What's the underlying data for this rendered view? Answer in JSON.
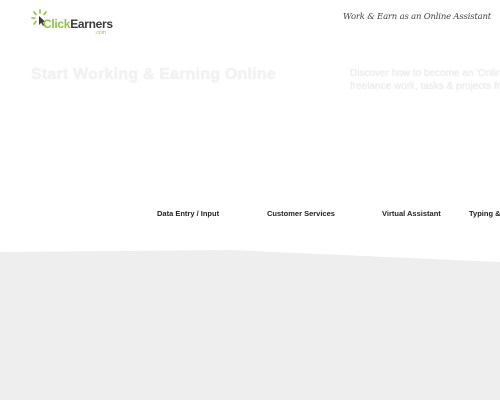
{
  "header": {
    "logo": {
      "name_part1": "Click",
      "name_part2": "Earners",
      "domain": ".com",
      "icon": "click-burst-icon",
      "accent_color": "#8cc63f"
    },
    "tagline": "Work & Earn as an Online Assistant"
  },
  "hero": {
    "title": "Start Working & Earning Online",
    "description_line1": "Discover how to become an 'Online",
    "description_line2": "freelance work, tasks & projects fro"
  },
  "categories": [
    {
      "label": "Data Entry / Input"
    },
    {
      "label": "Customer Services"
    },
    {
      "label": "Virtual Assistant"
    },
    {
      "label": "Typing & Tr"
    }
  ],
  "colors": {
    "background": "#ffffff",
    "bottom_band": "#eeeeee"
  }
}
